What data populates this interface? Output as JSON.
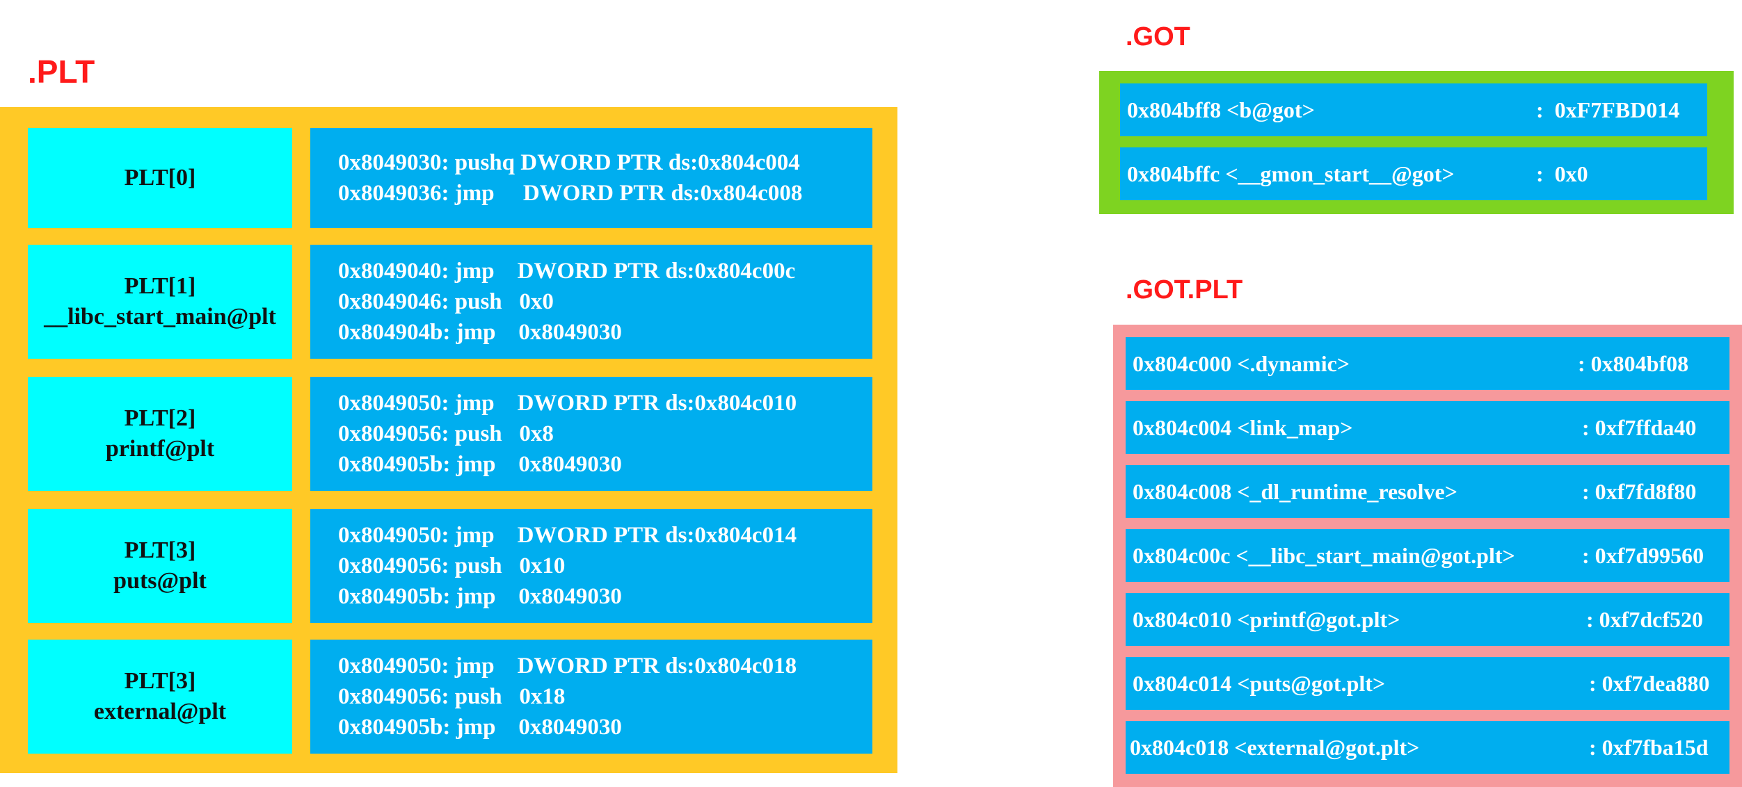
{
  "plt": {
    "title": ".PLT",
    "entries": [
      {
        "name": "PLT[0]",
        "symbol": "",
        "code": [
          "0x8049030: pushq DWORD PTR ds:0x804c004",
          "0x8049036: jmp     DWORD PTR ds:0x804c008"
        ]
      },
      {
        "name": "PLT[1]",
        "symbol": "__libc_start_main@plt",
        "code": [
          "0x8049040: jmp    DWORD PTR ds:0x804c00c",
          "0x8049046: push   0x0",
          "0x804904b: jmp    0x8049030"
        ]
      },
      {
        "name": "PLT[2]",
        "symbol": "printf@plt",
        "code": [
          "0x8049050: jmp    DWORD PTR ds:0x804c010",
          "0x8049056: push   0x8",
          "0x804905b: jmp    0x8049030"
        ]
      },
      {
        "name": "PLT[3]",
        "symbol": "puts@plt",
        "code": [
          "0x8049050: jmp    DWORD PTR ds:0x804c014",
          "0x8049056: push   0x10",
          "0x804905b: jmp    0x8049030"
        ]
      },
      {
        "name": "PLT[3]",
        "symbol": "external@plt",
        "code": [
          "0x8049050: jmp    DWORD PTR ds:0x804c018",
          "0x8049056: push   0x18",
          "0x804905b: jmp    0x8049030"
        ]
      }
    ]
  },
  "got": {
    "title": ".GOT",
    "entries": [
      {
        "addr": "0x804bff8 <b@got>",
        "value": ":  0xF7FBD014"
      },
      {
        "addr": "0x804bffc <__gmon_start__@got>",
        "value": ":  0x0"
      }
    ]
  },
  "got_plt": {
    "title": ".GOT.PLT",
    "entries": [
      {
        "addr": "0x804c000 <.dynamic>",
        "value": ": 0x804bf08"
      },
      {
        "addr": "0x804c004 <link_map>",
        "value": ": 0xf7ffda40"
      },
      {
        "addr": "0x804c008 <_dl_runtime_resolve>",
        "value": ": 0xf7fd8f80"
      },
      {
        "addr": "0x804c00c <__libc_start_main@got.plt>",
        "value": ": 0xf7d99560"
      },
      {
        "addr": "0x804c010 <printf@got.plt>",
        "value": ": 0xf7dcf520"
      },
      {
        "addr": "0x804c014 <puts@got.plt>",
        "value": ": 0xf7dea880"
      },
      {
        "addr": "0x804c018 <external@got.plt>",
        "value": ": 0xf7fba15d"
      }
    ]
  },
  "colors": {
    "plt_frame": "#ffc926",
    "got_frame": "#7ed321",
    "got_plt_frame": "#f6999c",
    "label_cell": "#00ffff",
    "code_cell": "#00aeef",
    "title": "#ff1a1a"
  }
}
